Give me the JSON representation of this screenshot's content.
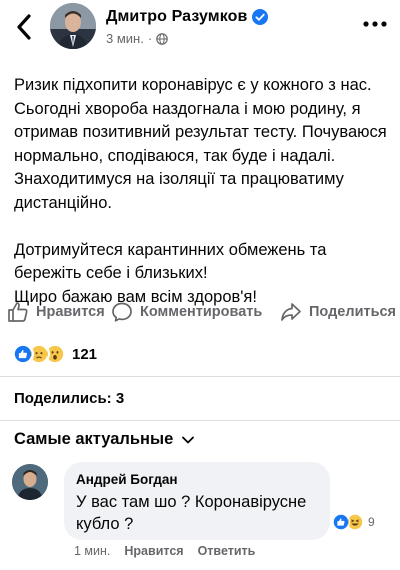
{
  "post": {
    "author": "Дмитро Разумков",
    "time": "3 мин.",
    "dot": "·",
    "text": "Ризик підхопити коронавірус є у кожного з нас. Сьогодні хвороба наздогнала і мою родину, я отримав позитивний результат тесту. Почуваюся нормально, сподіваюся, так буде і надалі. Знаходитимуся на ізоляції та працюватиму дистанційно.\n\nДотримуйтеся карантинних обмежень та бережіть себе і близьких!\nЩиро бажаю вам всім здоров'я!"
  },
  "actions": {
    "like": "Нравится",
    "comment": "Комментировать",
    "share": "Поделиться"
  },
  "reactions": {
    "count": "121",
    "types": [
      "like",
      "sad",
      "wow"
    ]
  },
  "shares_text": "Поделились: 3",
  "comments": {
    "sort_label": "Самые актуальные",
    "items": [
      {
        "author": "Андрей Богдан",
        "text": "У вас там шо ? Коронавірусне кубло ?",
        "reaction_count": "9",
        "time": "1 мин.",
        "like_label": "Нравится",
        "reply_label": "Ответить"
      }
    ]
  },
  "colors": {
    "accent": "#1877f2",
    "secondary_text": "#65676b",
    "bubble": "#f0f2f5"
  }
}
